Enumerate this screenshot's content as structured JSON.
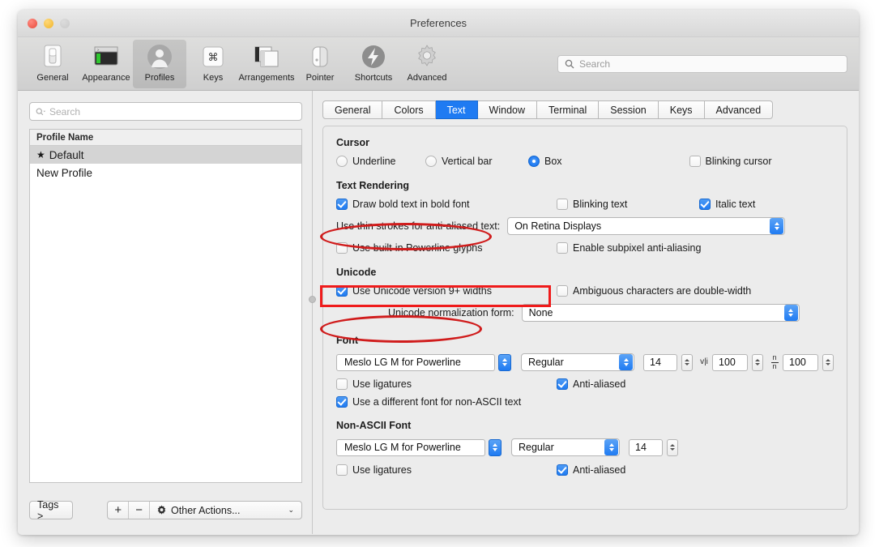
{
  "window": {
    "title": "Preferences",
    "traffic_lights": [
      "close-red",
      "minimize-yellow",
      "zoom-gray-disabled"
    ]
  },
  "toolbar": {
    "items": [
      {
        "label": "General",
        "icon": "general-icon",
        "selected": false
      },
      {
        "label": "Appearance",
        "icon": "appearance-icon",
        "selected": false
      },
      {
        "label": "Profiles",
        "icon": "profiles-icon",
        "selected": true
      },
      {
        "label": "Keys",
        "icon": "keys-icon",
        "selected": false
      },
      {
        "label": "Arrangements",
        "icon": "arrangements-icon",
        "selected": false
      },
      {
        "label": "Pointer",
        "icon": "pointer-icon",
        "selected": false
      },
      {
        "label": "Shortcuts",
        "icon": "shortcuts-icon",
        "selected": false
      },
      {
        "label": "Advanced",
        "icon": "advanced-icon",
        "selected": false
      }
    ],
    "search": {
      "placeholder": "Search",
      "value": "",
      "icon": "search-icon"
    }
  },
  "sidebar": {
    "search": {
      "placeholder": "Search",
      "value": "",
      "icon": "search-icon"
    },
    "table": {
      "header": "Profile Name",
      "rows": [
        {
          "name": "Default",
          "starred": true,
          "star": "★",
          "selected": true
        },
        {
          "name": "New Profile",
          "starred": false,
          "star": "",
          "selected": false
        }
      ]
    },
    "footer": {
      "tags_label": "Tags >",
      "add_label": "+",
      "remove_label": "−",
      "other_actions_label": "Other Actions...",
      "other_actions_icon": "gear-icon",
      "chevron": "⌄"
    }
  },
  "main": {
    "tabs": [
      {
        "label": "General",
        "selected": false
      },
      {
        "label": "Colors",
        "selected": false
      },
      {
        "label": "Text",
        "selected": true
      },
      {
        "label": "Window",
        "selected": false
      },
      {
        "label": "Terminal",
        "selected": false
      },
      {
        "label": "Session",
        "selected": false
      },
      {
        "label": "Keys",
        "selected": false
      },
      {
        "label": "Advanced",
        "selected": false
      }
    ],
    "cursor": {
      "title": "Cursor",
      "options": [
        {
          "label": "Underline",
          "selected": false
        },
        {
          "label": "Vertical bar",
          "selected": false
        },
        {
          "label": "Box",
          "selected": true
        }
      ],
      "blinking": {
        "label": "Blinking cursor",
        "checked": false
      }
    },
    "text_rendering": {
      "title": "Text Rendering",
      "draw_bold": {
        "label": "Draw bold text in bold font",
        "checked": true
      },
      "blinking_text": {
        "label": "Blinking text",
        "checked": false
      },
      "italic_text": {
        "label": "Italic text",
        "checked": true
      },
      "thin_strokes_label": "Use thin strokes for anti-aliased text:",
      "thin_strokes_value": "On Retina Displays",
      "powerline": {
        "label": "Use built-in Powerline glyphs",
        "checked": false
      },
      "subpixel": {
        "label": "Enable subpixel anti-aliasing",
        "checked": false
      }
    },
    "unicode": {
      "title": "Unicode",
      "version9": {
        "label": "Use Unicode version 9+ widths",
        "checked": true
      },
      "ambiguous": {
        "label": "Ambiguous characters are double-width",
        "checked": false
      },
      "normalization_label": "Unicode normalization form:",
      "normalization_value": "None"
    },
    "font": {
      "title": "Font",
      "family": "Meslo LG M for Powerline",
      "style": "Regular",
      "size": "14",
      "horizontal_spacing_icon": "horizontal-spacing-icon",
      "horizontal_spacing": "100",
      "vertical_spacing_icon": "vertical-spacing-icon",
      "vertical_spacing": "100",
      "ligatures": {
        "label": "Use ligatures",
        "checked": false
      },
      "antialiased": {
        "label": "Anti-aliased",
        "checked": true
      },
      "different_font": {
        "label": "Use a different font for non-ASCII text",
        "checked": true
      }
    },
    "non_ascii_font": {
      "title": "Non-ASCII Font",
      "family": "Meslo LG M for Powerline",
      "style": "Regular",
      "size": "14",
      "ligatures": {
        "label": "Use ligatures",
        "checked": false
      },
      "antialiased": {
        "label": "Anti-aliased",
        "checked": true
      }
    }
  },
  "annotations": {
    "accent_color": "#d01c1c",
    "rect_color": "#ef1b1b",
    "shapes": [
      {
        "type": "oval",
        "target": "font-family-combo"
      },
      {
        "type": "rect",
        "target": "use-different-font-checkbox"
      },
      {
        "type": "oval",
        "target": "non-ascii-font-family-combo"
      }
    ]
  }
}
